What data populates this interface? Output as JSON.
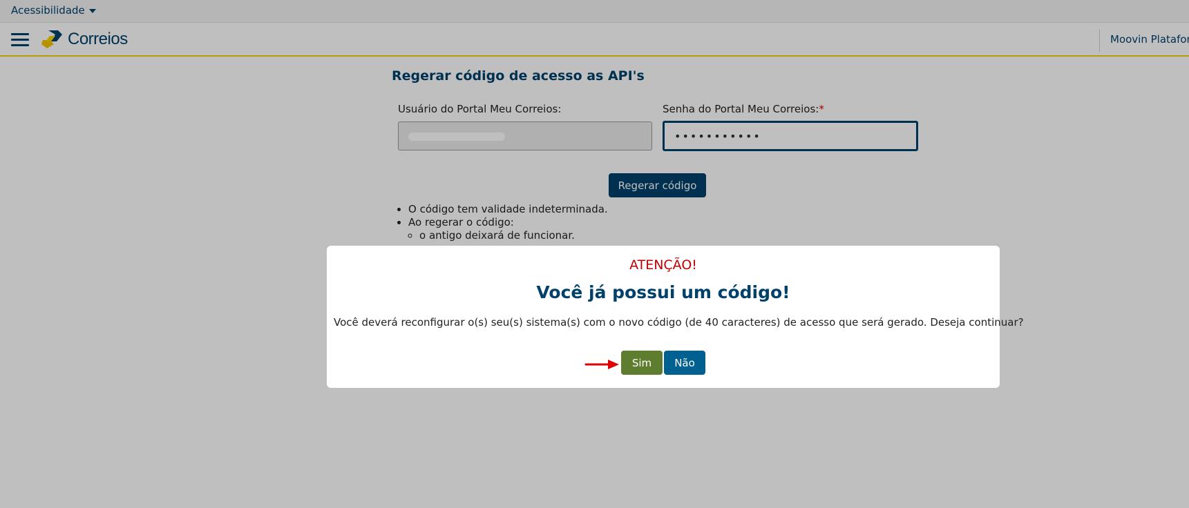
{
  "accessibility": {
    "label": "Acessibilidade"
  },
  "header": {
    "logo_text": "Correios",
    "right_label": "Moovin Plataforma"
  },
  "main": {
    "title": "Regerar código de acesso as API's",
    "user_label": "Usuário do Portal Meu Correios:",
    "password_label": "Senha do Portal Meu Correios:",
    "required_mark": "*",
    "password_value": "•••••••••••",
    "regenerate_button": "Regerar código",
    "notes": [
      "O código tem validade indeterminada.",
      "Ao regerar o código:"
    ],
    "subnotes": [
      "o antigo deixará de funcionar."
    ]
  },
  "modal": {
    "alert": "ATENÇÃO!",
    "title": "Você já possui um código!",
    "message": "Você deverá reconfigurar o(s) seu(s) sistema(s) com o novo código (de 40 caracteres) de acesso que será gerado. Deseja continuar?",
    "yes_button": "Sim",
    "no_button": "Não"
  },
  "colors": {
    "brand_blue": "#00416b",
    "brand_yellow": "#f6d200",
    "yes_green": "#5f7d2f",
    "alert_red": "#c00000",
    "annotation_arrow": "#e00000"
  }
}
